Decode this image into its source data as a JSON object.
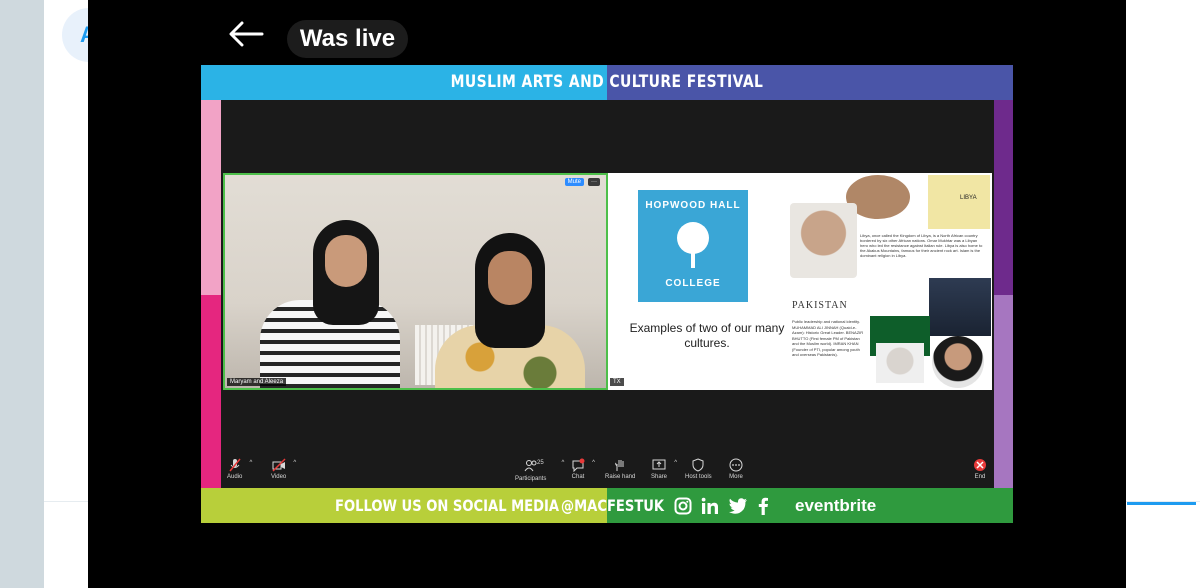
{
  "background": {
    "avatar_letter": "A"
  },
  "player": {
    "status_label": "Was live"
  },
  "festival": {
    "title": "MUSLIM ARTS AND CULTURE FESTIVAL",
    "footer_follow": "FOLLOW US ON SOCIAL MEDIA",
    "footer_handle": "@MACFESTUK",
    "footer_brand": "eventbrite",
    "colors": {
      "top_left": "#2bb3e6",
      "top_right": "#4a55a8",
      "bottom_left": "#b8cf3a",
      "bottom_right": "#2f9a3e"
    }
  },
  "video_tile": {
    "mute_label": "Mute",
    "more_label": "···",
    "participant_name": "Maryam and Aleeza"
  },
  "slide": {
    "college_top": "HOPWOOD HALL",
    "college_bottom": "COLLEGE",
    "caption": "Examples of two of our many cultures.",
    "libya_map_label": "LIBYA",
    "libya_text": "Libya, once called the Kingdom of Libya, is a North African country bordered by six other African nations. Omar Mukhtar was a Libyan hero who led the resistance against Italian rule. Libya is also home to the Akakus Mountains, famous for their ancient rock art. Islam is the dominant religion in Libya.",
    "pakistan_title": "PAKISTAN",
    "pakistan_text": "Public leadership and national identity. MUHAMMAD ALI JINNAH (Quaid-e-Azam): Historic Great Leader. BENAZIR BHUTTO (First female PM of Pakistan and the Muslim world). IMRAN KHAN (Founder of PTI, popular among youth and overseas Pakistanis).",
    "share_label": "TX"
  },
  "toolbar": {
    "audio": "Audio",
    "video": "Video",
    "participants": "Participants",
    "participants_count": "25",
    "chat": "Chat",
    "raise_hand": "Raise hand",
    "share": "Share",
    "host_tools": "Host tools",
    "more": "More",
    "end": "End"
  }
}
